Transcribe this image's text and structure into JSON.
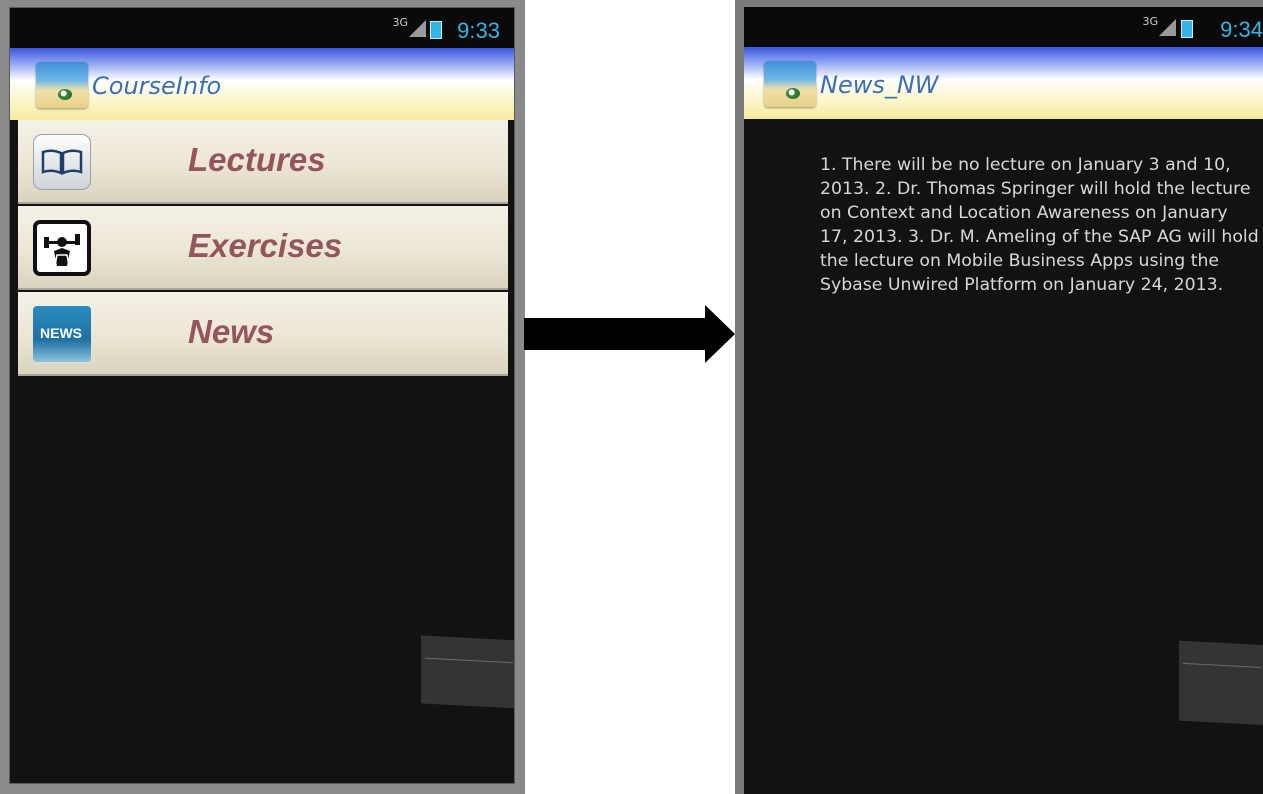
{
  "left_screen": {
    "status": {
      "network": "3G",
      "time": "9:33"
    },
    "app_title": "CourseInfo",
    "menu": [
      {
        "label": "Lectures",
        "icon": "book-icon"
      },
      {
        "label": "Exercises",
        "icon": "dumbbell-icon"
      },
      {
        "label": "News",
        "icon": "news-icon",
        "icon_text": "NEWS"
      }
    ]
  },
  "right_screen": {
    "status": {
      "network": "3G",
      "time": "9:34"
    },
    "app_title": "News_NW",
    "body": "1. There will be no lecture on January 3 and 10, 2013. 2. Dr. Thomas Springer will hold the lecture on Context and Location Awareness on January 17, 2013. 3. Dr. M. Ameling of the SAP AG will hold the lecture on Mobile Business Apps using the Sybase Unwired Platform on January 24, 2013."
  },
  "colors": {
    "clock": "#33b5e5",
    "title_text": "#3a6fb6",
    "menu_label": "#94555e",
    "background": "#121212"
  }
}
